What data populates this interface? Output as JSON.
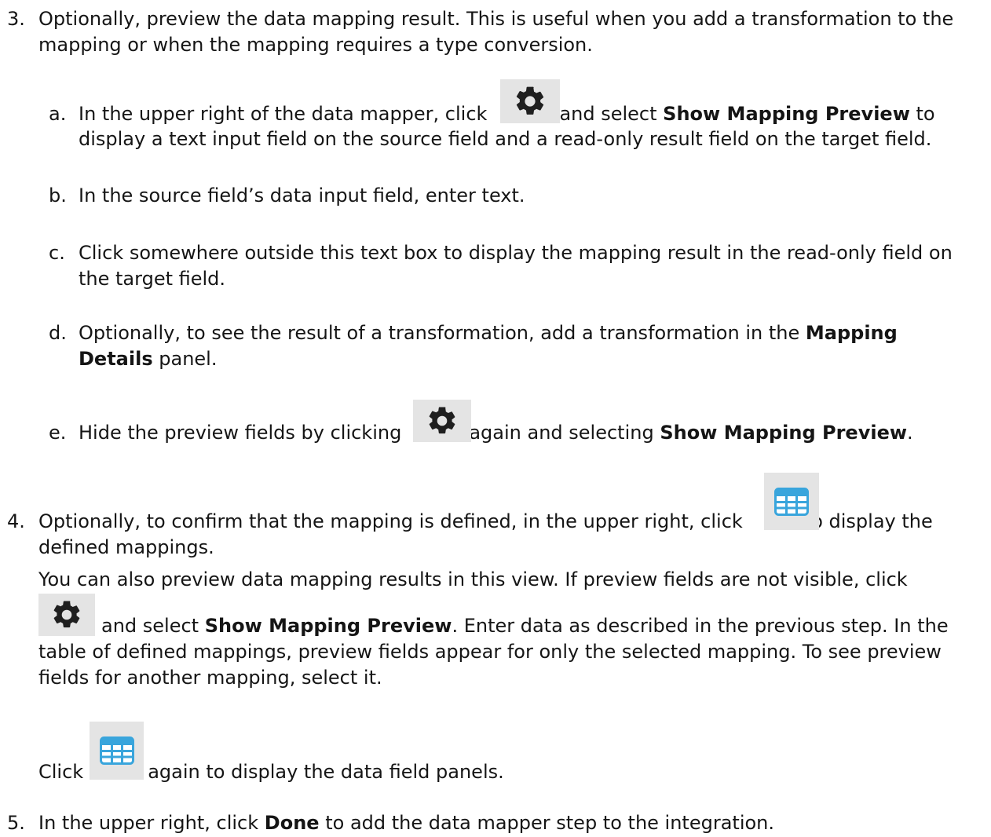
{
  "step3": {
    "number": "3.",
    "intro_line1": "Optionally, preview the data mapping result. This is useful when you add a transformation to the",
    "intro_line2": "mapping or when the mapping requires a type conversion.",
    "a": {
      "marker": "a.",
      "pre": "In the upper right of the data mapper, click",
      "mid": "and select",
      "bold": "Show Mapping Preview",
      "post": "to",
      "line2": "display a text input field on the source field and a read-only result field on the target field."
    },
    "b": {
      "marker": "b.",
      "text": "In the source field’s data input field, enter text."
    },
    "c": {
      "marker": "c.",
      "line1": "Click somewhere outside this text box to display the mapping result in the read-only field on",
      "line2": "the target field."
    },
    "d": {
      "marker": "d.",
      "pre": "Optionally, to see the result of a transformation, add a transformation in the",
      "bold1": "Mapping",
      "bold2": "Details",
      "post": "panel."
    },
    "e": {
      "marker": "e.",
      "pre": "Hide the preview fields by clicking",
      "mid": "again and selecting",
      "bold": "Show Mapping Preview",
      "post": "."
    }
  },
  "step4": {
    "number": "4.",
    "pre": "Optionally, to confirm that the mapping is defined, in the upper right, click",
    "post": "to display the",
    "line2": "defined mappings.",
    "line3": "You can also preview data mapping results in this view. If preview fields are not visible, click",
    "line4_mid": "and select",
    "line4_bold": "Show Mapping Preview",
    "line4_post": ". Enter data as described in the previous step. In the",
    "line5": "table of defined mappings, preview fields appear for only the selected mapping. To see preview",
    "line6": "fields for another mapping, select it.",
    "click_pre": "Click",
    "click_post": "again to display the data field panels."
  },
  "step5": {
    "number": "5.",
    "pre": "In the upper right, click",
    "bold": "Done",
    "post": "to add the data mapper step to the integration."
  },
  "icons": {
    "settings": "gear-icon",
    "mapping_table": "grid-table-icon",
    "gear_color": "#1f1f1f",
    "grid_color": "#39a5dc",
    "icon_bg": "#e4e4e4"
  }
}
